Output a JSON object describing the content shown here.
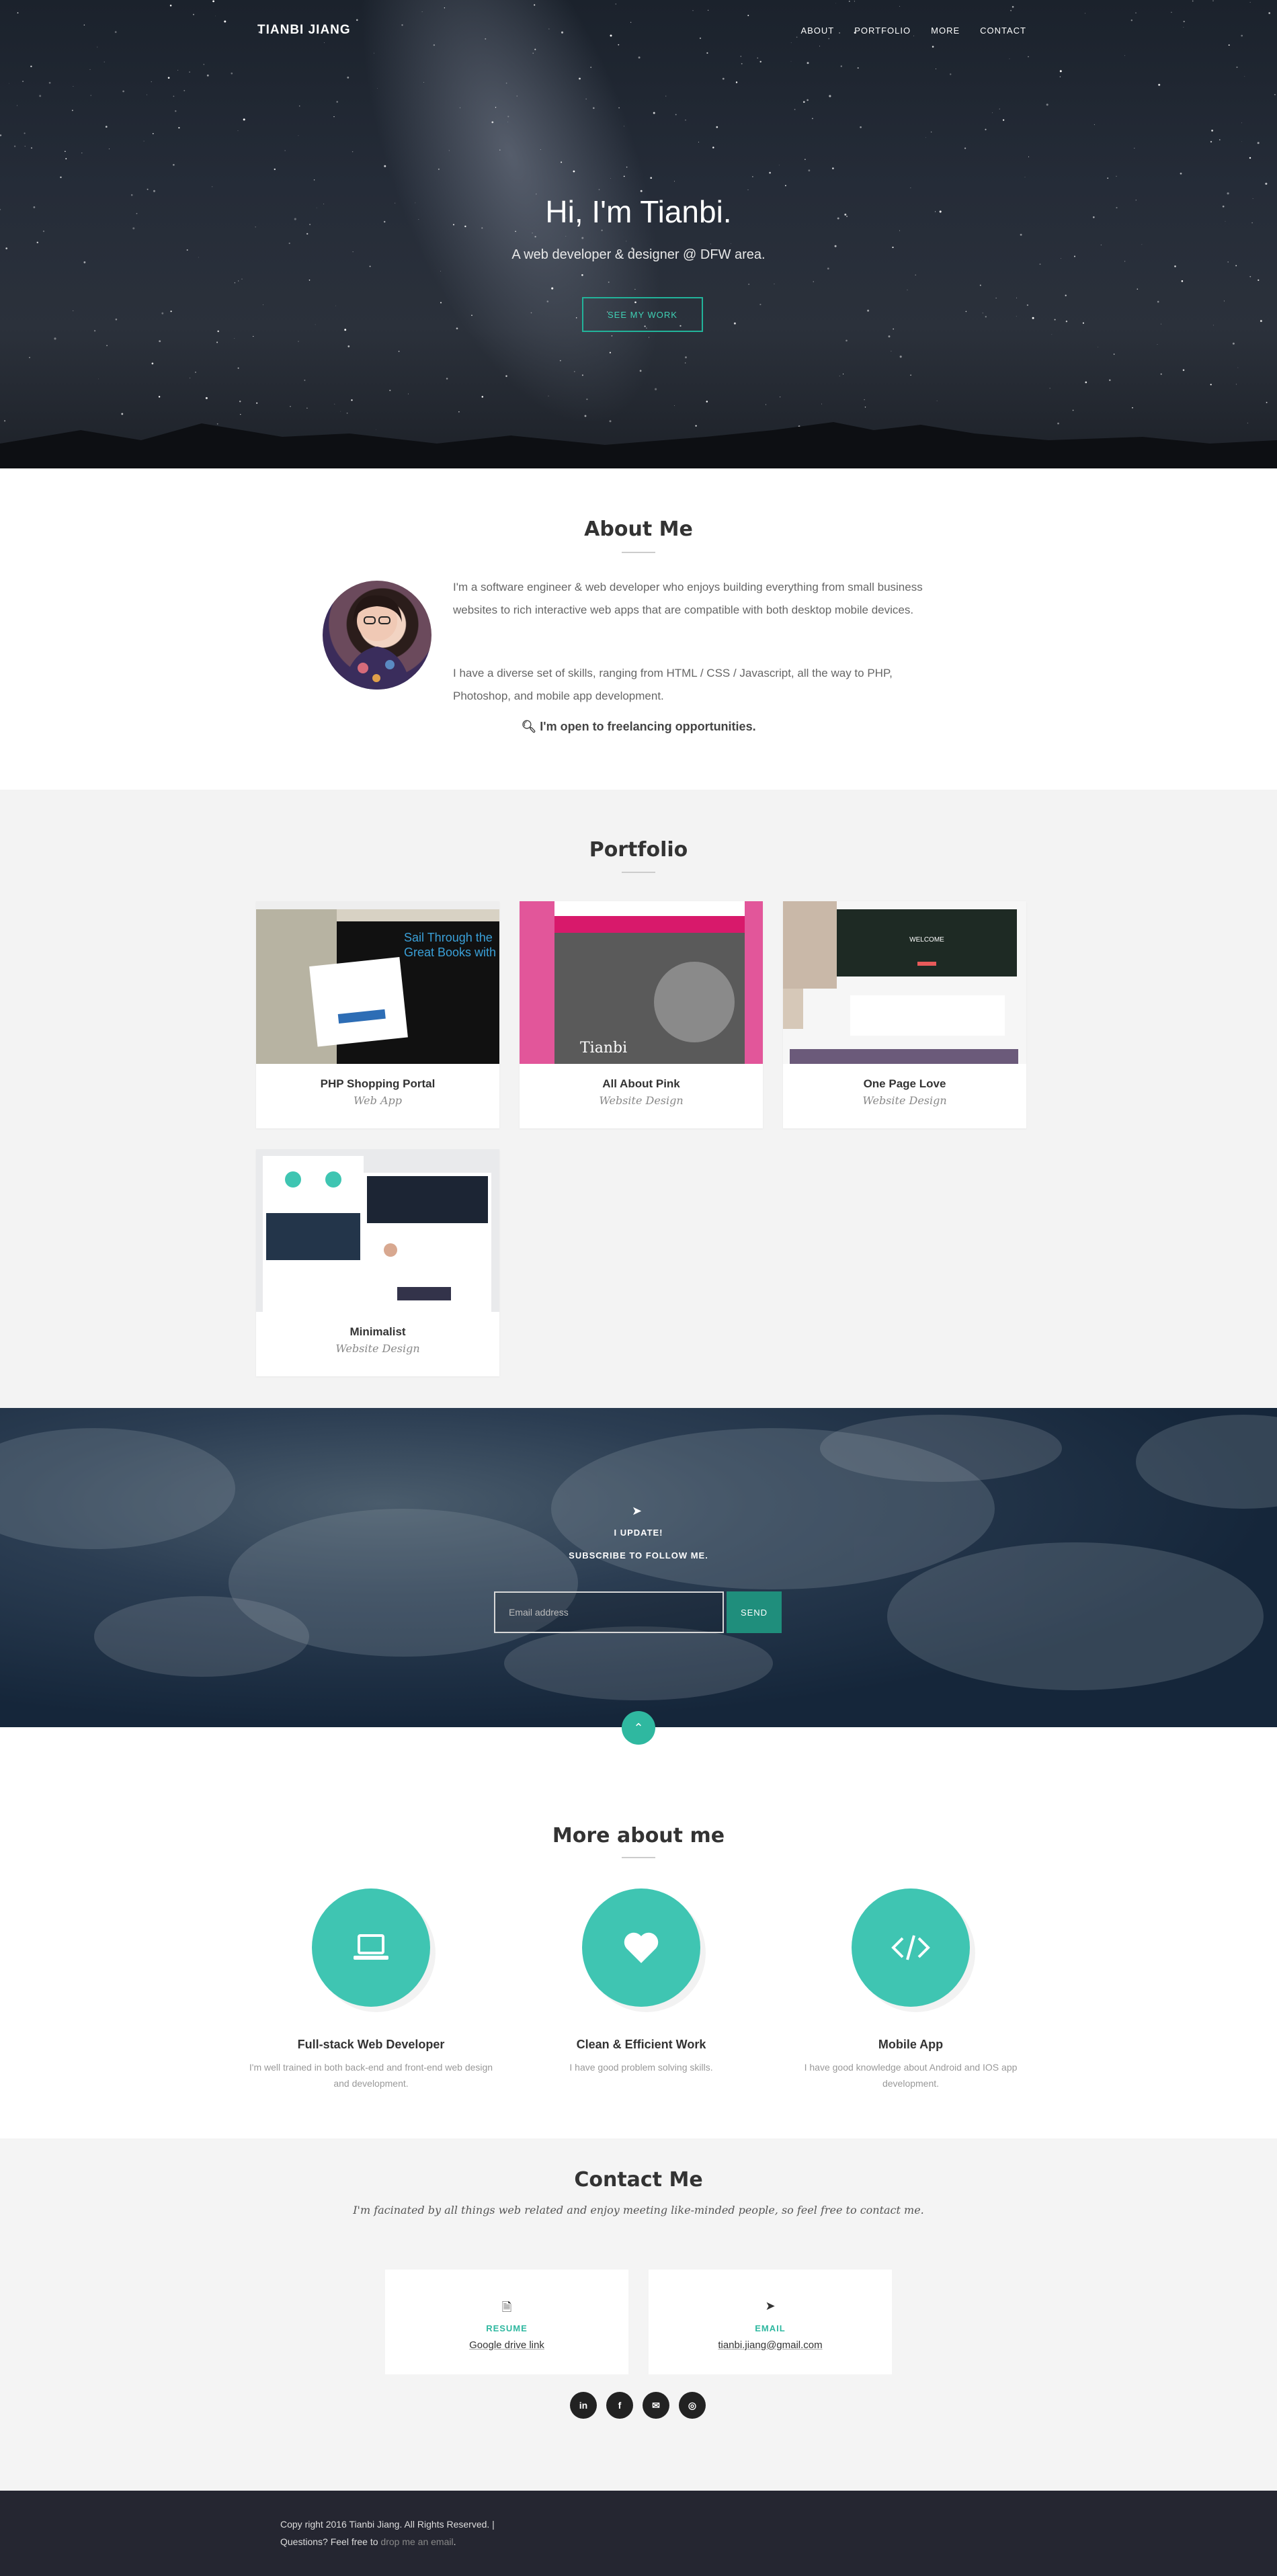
{
  "nav": {
    "brand": "TIANBI JIANG",
    "links": [
      "ABOUT",
      "PORTFOLIO",
      "MORE",
      "CONTACT"
    ]
  },
  "hero": {
    "title": "Hi, I'm Tianbi.",
    "subtitle": "A web developer & designer @ DFW area.",
    "button": "SEE MY WORK"
  },
  "about": {
    "title": "About Me",
    "p1": "I'm a software engineer & web developer who enjoys building everything from small business websites to rich interactive web apps that are compatible with both desktop mobile devices.",
    "p2": "I have a diverse set of skills, ranging from HTML / CSS / Javascript, all the way to PHP, Photoshop, and mobile app development.",
    "freelance": "I'm open to freelancing opportunities.",
    "freelance_icon": "search-icon"
  },
  "portfolio": {
    "title": "Portfolio",
    "items": [
      {
        "title": "PHP Shopping Portal",
        "type": "Web App"
      },
      {
        "title": "All About Pink",
        "type": "Website Design"
      },
      {
        "title": "One Page Love",
        "type": "Website Design"
      },
      {
        "title": "Minimalist",
        "type": "Website Design"
      }
    ]
  },
  "subscribe": {
    "icon": "paper-plane-icon",
    "line1": "I UPDATE!",
    "line2": "SUBSCRIBE TO FOLLOW ME.",
    "placeholder": "Email address",
    "button": "SEND"
  },
  "more": {
    "title": "More about me",
    "items": [
      {
        "icon": "laptop-icon",
        "title": "Full-stack Web Developer",
        "desc": "I'm well trained in both back-end and front-end web design and development."
      },
      {
        "icon": "heart-icon",
        "title": "Clean & Efficient Work",
        "desc": "I have good problem solving skills."
      },
      {
        "icon": "code-icon",
        "title": "Mobile App",
        "desc": "I have good knowledge about Android and IOS app development."
      }
    ]
  },
  "contact": {
    "title": "Contact Me",
    "subtitle": "I'm facinated by all things web related and enjoy meeting like-minded people, so feel free to contact me.",
    "cards": [
      {
        "icon": "file-icon",
        "label": "RESUME",
        "value": "Google drive link"
      },
      {
        "icon": "paper-plane-icon",
        "label": "EMAIL",
        "value": "tianbi.jiang@gmail.com"
      }
    ],
    "social": [
      {
        "icon": "linkedin-icon",
        "glyph": "in"
      },
      {
        "icon": "facebook-icon",
        "glyph": "f"
      },
      {
        "icon": "mail-icon",
        "glyph": "✉"
      },
      {
        "icon": "instagram-icon",
        "glyph": "◎"
      }
    ]
  },
  "footer": {
    "copyright": "Copy right 2016 Tianbi Jiang. All Rights Reserved. |",
    "question": "Questions? Feel free to",
    "link": "drop me an email",
    "end": "."
  },
  "colors": {
    "accent": "#3fc5b2",
    "footer_bg": "#252631"
  }
}
